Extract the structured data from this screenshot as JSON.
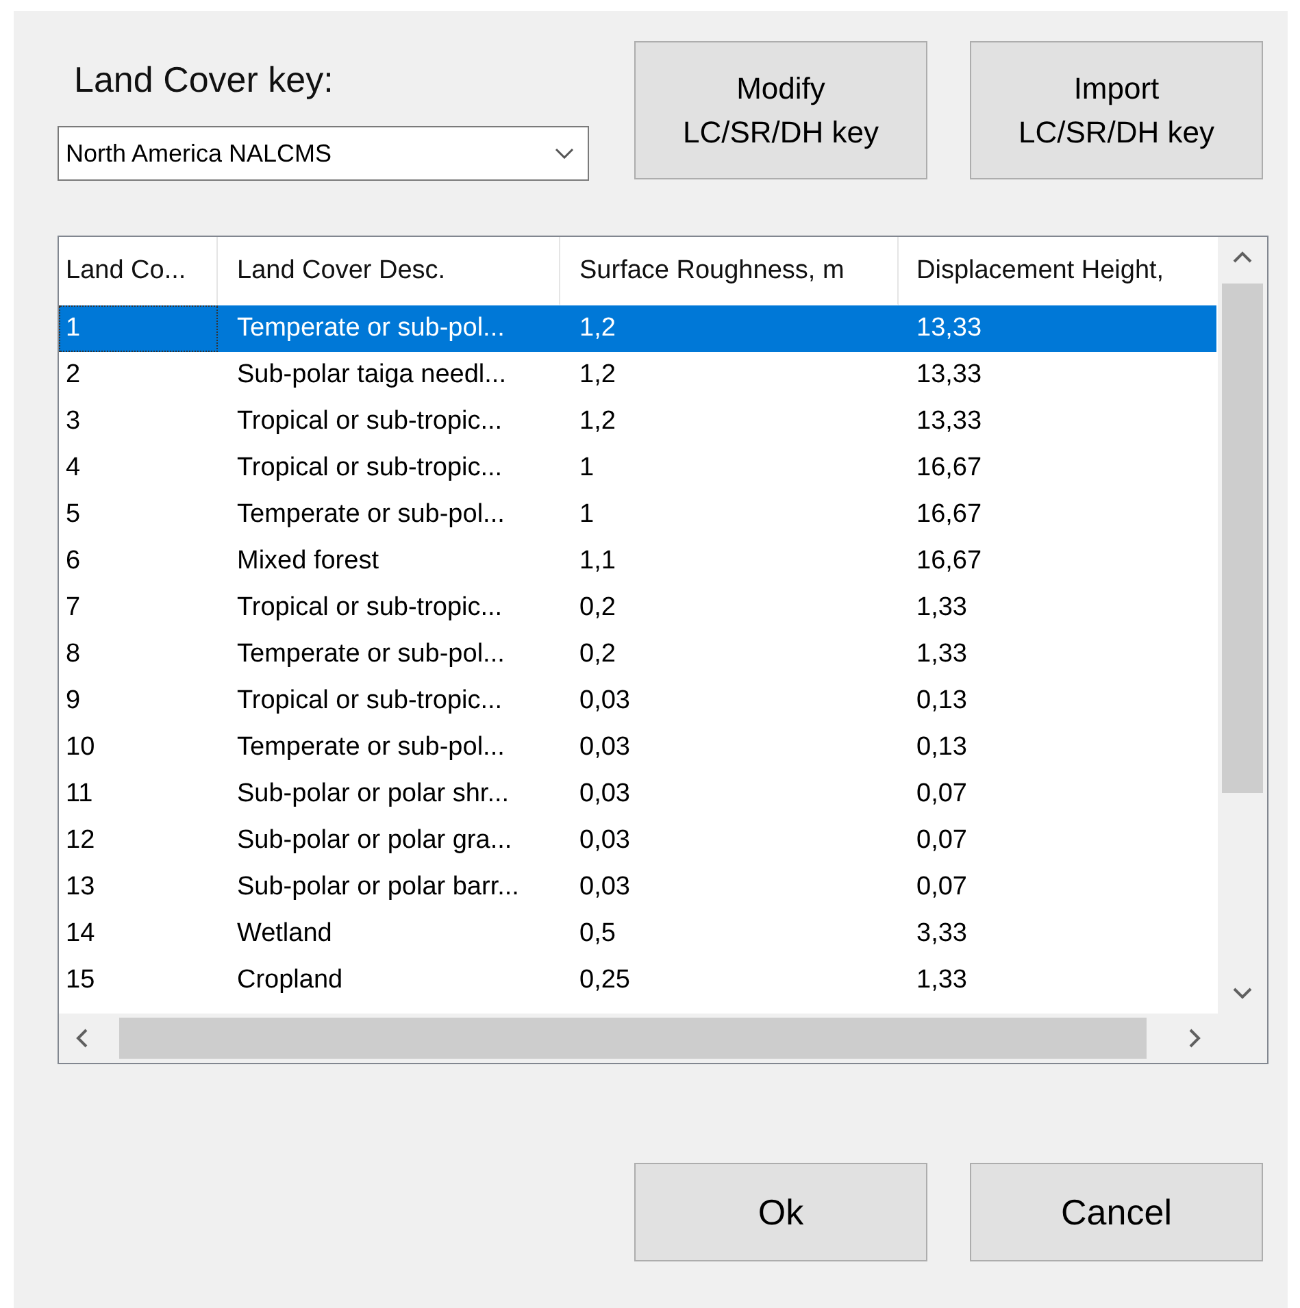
{
  "key_label": "Land Cover key:",
  "key_dropdown": {
    "value": "North America NALCMS"
  },
  "top_buttons": [
    "Modify\nLC/SR/DH key",
    "Import\nLC/SR/DH key"
  ],
  "table": {
    "columns": [
      "Land Co...",
      "Land Cover Desc.",
      "Surface Roughness, m",
      "Displacement Height,"
    ],
    "rows": [
      {
        "selected": true,
        "cells": [
          "1",
          "Temperate or sub-pol...",
          "1,2",
          "13,33"
        ]
      },
      {
        "selected": false,
        "cells": [
          "2",
          "Sub-polar taiga needl...",
          "1,2",
          "13,33"
        ]
      },
      {
        "selected": false,
        "cells": [
          "3",
          "Tropical or sub-tropic...",
          "1,2",
          "13,33"
        ]
      },
      {
        "selected": false,
        "cells": [
          "4",
          "Tropical or sub-tropic...",
          "1",
          "16,67"
        ]
      },
      {
        "selected": false,
        "cells": [
          "5",
          "Temperate or sub-pol...",
          "1",
          "16,67"
        ]
      },
      {
        "selected": false,
        "cells": [
          "6",
          "Mixed forest",
          "1,1",
          "16,67"
        ]
      },
      {
        "selected": false,
        "cells": [
          "7",
          "Tropical or sub-tropic...",
          "0,2",
          "1,33"
        ]
      },
      {
        "selected": false,
        "cells": [
          "8",
          "Temperate or sub-pol...",
          "0,2",
          "1,33"
        ]
      },
      {
        "selected": false,
        "cells": [
          "9",
          "Tropical or sub-tropic...",
          "0,03",
          "0,13"
        ]
      },
      {
        "selected": false,
        "cells": [
          "10",
          "Temperate or sub-pol...",
          "0,03",
          "0,13"
        ]
      },
      {
        "selected": false,
        "cells": [
          "11",
          "Sub-polar or polar shr...",
          "0,03",
          "0,07"
        ]
      },
      {
        "selected": false,
        "cells": [
          "12",
          "Sub-polar or polar gra...",
          "0,03",
          "0,07"
        ]
      },
      {
        "selected": false,
        "cells": [
          "13",
          "Sub-polar or polar barr...",
          "0,03",
          "0,07"
        ]
      },
      {
        "selected": false,
        "cells": [
          "14",
          "Wetland",
          "0,5",
          "3,33"
        ]
      },
      {
        "selected": false,
        "cells": [
          "15",
          "Cropland",
          "0,25",
          "1,33"
        ]
      }
    ]
  },
  "bottom_buttons": [
    "Ok",
    "Cancel"
  ]
}
